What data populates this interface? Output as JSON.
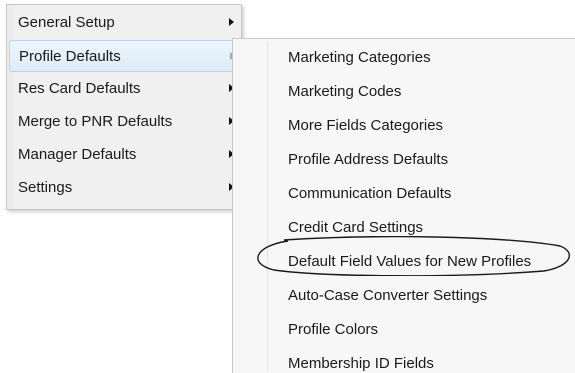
{
  "main_menu": {
    "items": [
      {
        "label": "General Setup",
        "has_submenu": true,
        "highlighted": false
      },
      {
        "label": "Profile Defaults",
        "has_submenu": true,
        "highlighted": true
      },
      {
        "label": "Res Card Defaults",
        "has_submenu": true,
        "highlighted": false
      },
      {
        "label": "Merge to PNR Defaults",
        "has_submenu": true,
        "highlighted": false
      },
      {
        "label": "Manager Defaults",
        "has_submenu": true,
        "highlighted": false
      },
      {
        "label": "Settings",
        "has_submenu": true,
        "highlighted": false
      }
    ]
  },
  "submenu": {
    "parent": "Profile Defaults",
    "items": [
      {
        "label": "Marketing Categories"
      },
      {
        "label": "Marketing Codes"
      },
      {
        "label": "More Fields Categories"
      },
      {
        "label": "Profile Address Defaults"
      },
      {
        "label": "Communication Defaults"
      },
      {
        "label": "Credit Card Settings"
      },
      {
        "label": "Default Field Values for New Profiles",
        "circled": true
      },
      {
        "label": "Auto-Case Converter Settings"
      },
      {
        "label": "Profile Colors"
      },
      {
        "label": "Membership ID Fields"
      }
    ]
  },
  "colors": {
    "menu_background": "#f0f0f0",
    "submenu_background": "#f7f7f7",
    "highlight_fill": "#dcebf8",
    "highlight_border": "#b8d3ee",
    "annotation_stroke": "#1a1a1a"
  }
}
